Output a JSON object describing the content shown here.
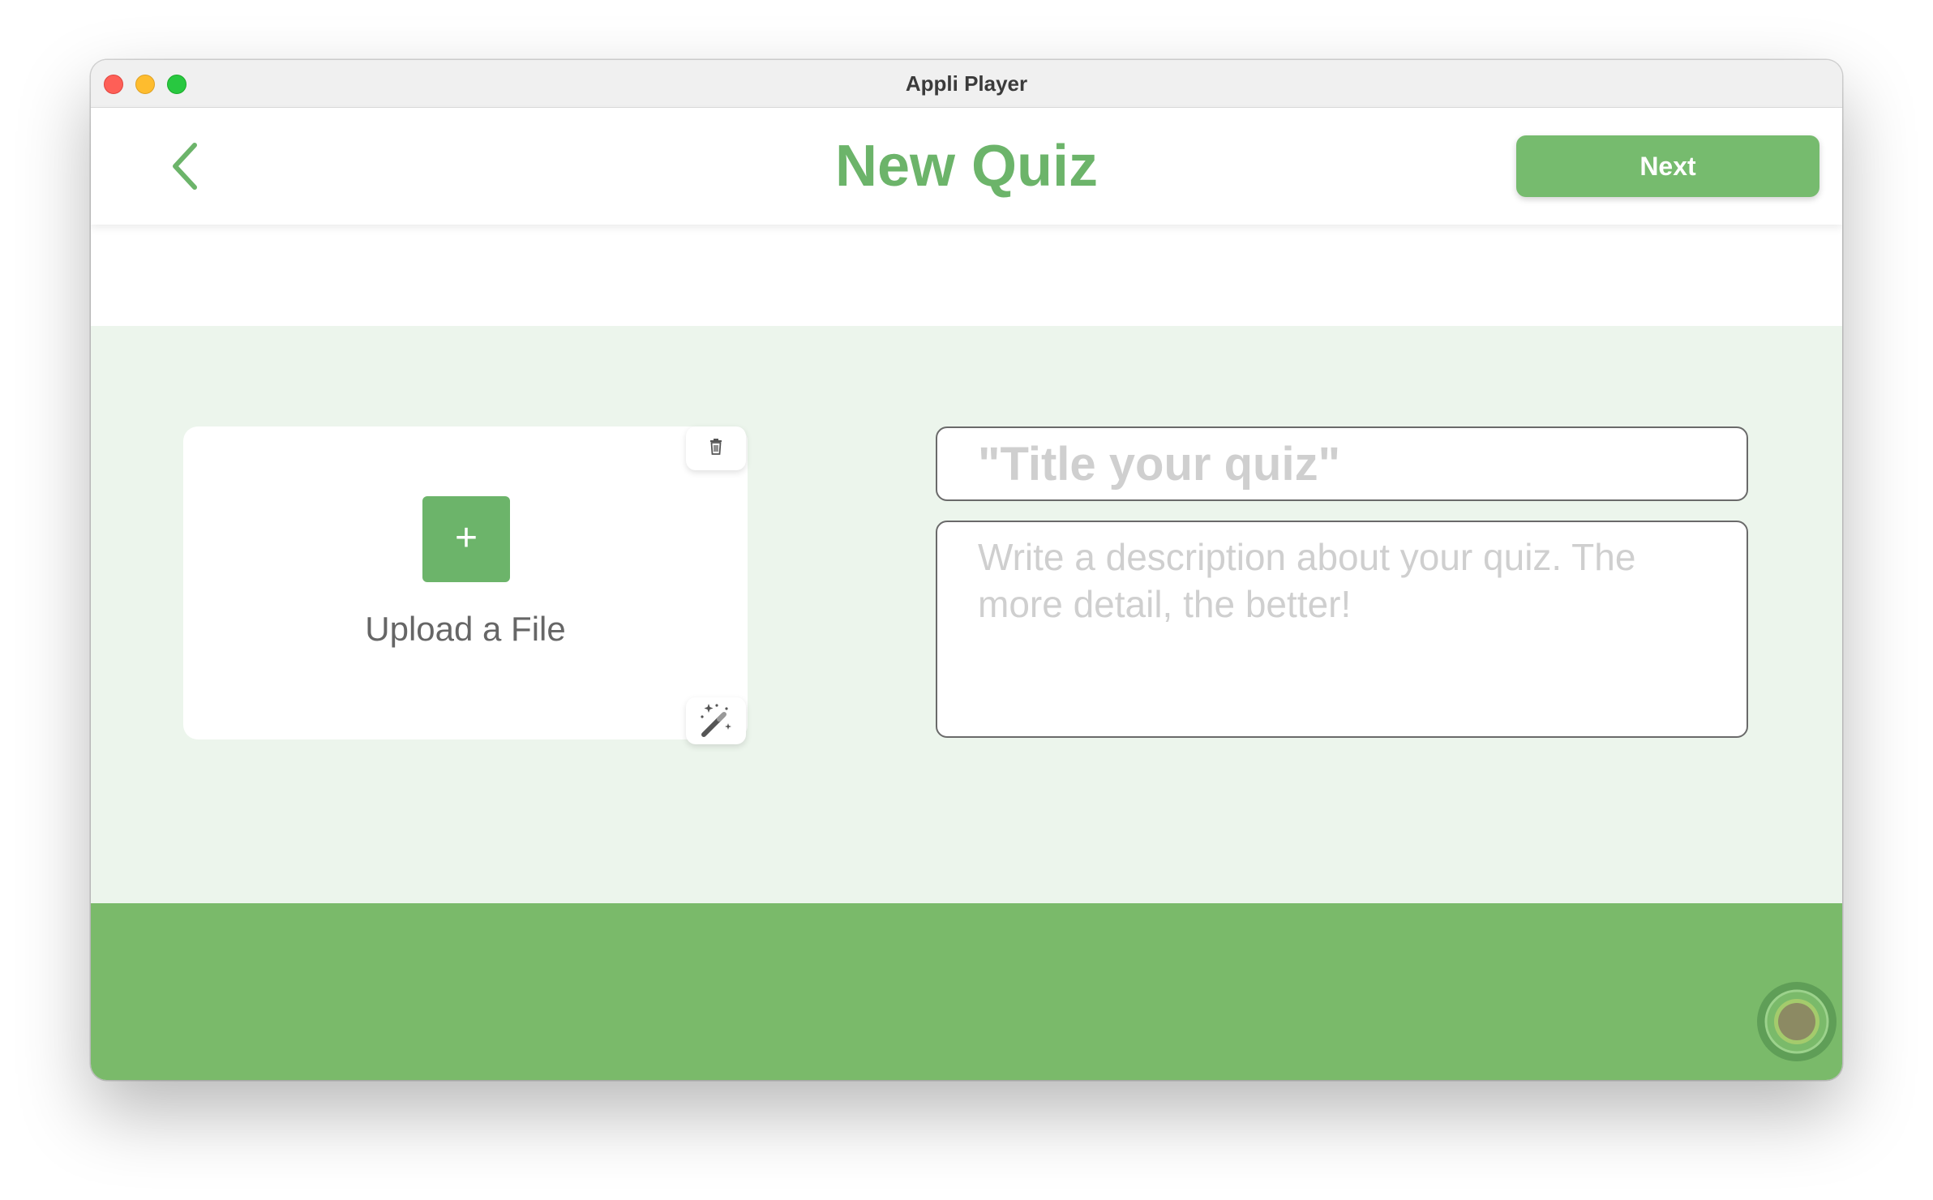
{
  "window": {
    "title": "Appli Player"
  },
  "header": {
    "title": "New Quiz",
    "next_label": "Next",
    "back_icon": "chevron-left-icon"
  },
  "upload": {
    "label": "Upload a File",
    "plus_symbol": "+",
    "trash_icon": "trash-icon",
    "wand_icon": "magic-wand-icon"
  },
  "form": {
    "title_placeholder": "\"Title your quiz\"",
    "title_value": "",
    "description_placeholder": "Write a description about your quiz. The more detail, the better!",
    "description_value": ""
  },
  "colors": {
    "accent": "#6cb46a",
    "button": "#76bb6e",
    "content_bg": "#ecf5ec",
    "footer_bg": "#7aba6a"
  }
}
